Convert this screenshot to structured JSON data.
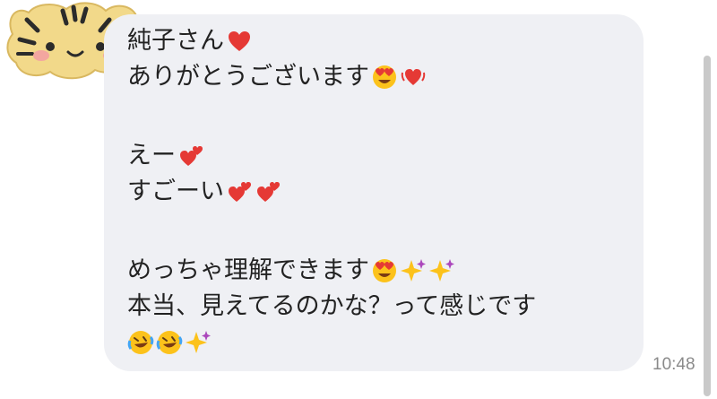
{
  "message": {
    "lines": [
      "純子さん",
      "ありがとうございます",
      "",
      "えー",
      "すごーい",
      "",
      "めっちゃ理解できます",
      "本当、見えてるのかな？って感じです",
      ""
    ],
    "emoji": {
      "heart": "red-heart-icon",
      "heart_eyes": "smiling-face-with-heart-eyes-icon",
      "beating_heart": "beating-heart-icon",
      "two_hearts": "two-hearts-icon",
      "sparkles": "sparkles-icon",
      "rofl": "rolling-on-floor-laughing-icon"
    },
    "time": "10:48"
  },
  "sender": {
    "avatar": "tiger-avatar-icon"
  },
  "colors": {
    "bubble": "#eff0f4",
    "text": "#222222",
    "timestamp": "#8a8a8a"
  }
}
